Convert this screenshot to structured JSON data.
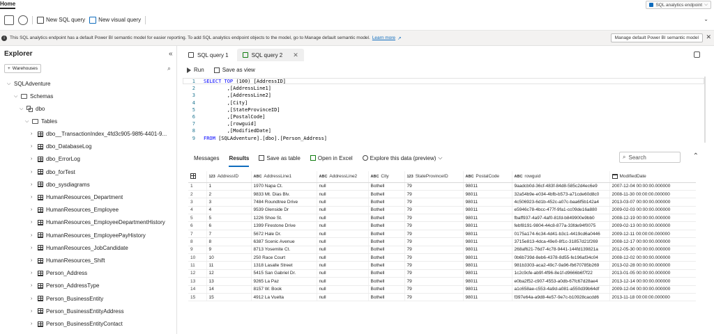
{
  "top": {
    "home_tab": "Home",
    "endpoint": "SQL analytics endpoint"
  },
  "ribbon": {
    "new_sql_query": "New SQL query",
    "new_visual_query": "New visual query"
  },
  "info": {
    "message": "This SQL analytics endpoint has a default Power BI semantic model for easier reporting. To add SQL analytics endpoint objects to the model, go to Manage default semantic model.",
    "learn_more": "Learn more",
    "manage_button": "Manage default Power BI semantic model"
  },
  "explorer": {
    "title": "Explorer",
    "warehouses_button": "Warehouses",
    "database": "SQLAdventure",
    "schemas": "Schemas",
    "schema_dbo": "dbo",
    "tables": "Tables",
    "table_items": [
      "dbo__TransactionIndex_4fd3c905-98f6-4401-9...",
      "dbo_DatabaseLog",
      "dbo_ErrorLog",
      "dbo_forTest",
      "dbo_sysdiagrams",
      "HumanResources_Department",
      "HumanResources_Employee",
      "HumanResources_EmployeeDepartmentHistory",
      "HumanResources_EmployeePayHistory",
      "HumanResources_JobCandidate",
      "HumanResources_Shift",
      "Person_Address",
      "Person_AddressType",
      "Person_BusinessEntity",
      "Person_BusinessEntityAddress",
      "Person_BusinessEntityContact"
    ]
  },
  "query_tabs": [
    {
      "label": "SQL query 1"
    },
    {
      "label": "SQL query 2"
    }
  ],
  "toolbar": {
    "run": "Run",
    "save_as_view": "Save as view"
  },
  "editor": {
    "lines": [
      {
        "n": "1",
        "kw": "SELECT TOP",
        "rest": " (100) [AddressID]"
      },
      {
        "n": "2",
        "kw": "",
        "rest": "        ,[AddressLine1]"
      },
      {
        "n": "3",
        "kw": "",
        "rest": "        ,[AddressLine2]"
      },
      {
        "n": "4",
        "kw": "",
        "rest": "        ,[City]"
      },
      {
        "n": "5",
        "kw": "",
        "rest": "        ,[StateProvinceID]"
      },
      {
        "n": "6",
        "kw": "",
        "rest": "        ,[PostalCode]"
      },
      {
        "n": "7",
        "kw": "",
        "rest": "        ,[rowguid]"
      },
      {
        "n": "8",
        "kw": "",
        "rest": "        ,[ModifiedDate]"
      },
      {
        "n": "9",
        "kw": "FROM",
        "rest": " [SQLAdventure].[dbo].[Person_Address]"
      }
    ]
  },
  "results": {
    "tab_messages": "Messages",
    "tab_results": "Results",
    "save_as_table": "Save as table",
    "open_in_excel": "Open in Excel",
    "explore": "Explore this data (preview)",
    "search_placeholder": "Search",
    "columns": [
      {
        "type": "123",
        "name": "AddressID"
      },
      {
        "type": "ABC",
        "name": "AddressLine1"
      },
      {
        "type": "ABC",
        "name": "AddressLine2"
      },
      {
        "type": "ABC",
        "name": "City"
      },
      {
        "type": "123",
        "name": "StateProvinceID"
      },
      {
        "type": "ABC",
        "name": "PostalCode"
      },
      {
        "type": "ABC",
        "name": "rowguid"
      },
      {
        "type": "",
        "name": "ModifiedDate"
      }
    ],
    "rows": [
      [
        "1",
        "1",
        "1970 Napa Ct.",
        "null",
        "Bothell",
        "79",
        "98011",
        "9aadcb0d-36cf-483f-84d8-585c2d4ec6e9",
        "2007-12-04 00:00:00.000000"
      ],
      [
        "2",
        "2",
        "9833 Mt. Dias Blv.",
        "null",
        "Bothell",
        "79",
        "98011",
        "32a54b9e-e034-4bfb-b573-a71cde60d8c0",
        "2008-11-30 00:00:00.000000"
      ],
      [
        "3",
        "3",
        "7484 Roundtree Drive",
        "null",
        "Bothell",
        "79",
        "98011",
        "4c506923-6d1b-452c-a07c-baa6f5b142a4",
        "2013-03-07 00:00:00.000000"
      ],
      [
        "4",
        "4",
        "9539 Glenside Dr",
        "null",
        "Bothell",
        "79",
        "98011",
        "e5946c78-4bcc-477f-9fa1-cc09de16a880",
        "2009-02-03 00:00:00.000000"
      ],
      [
        "5",
        "5",
        "1226 Shoe St.",
        "null",
        "Bothell",
        "79",
        "98011",
        "fbaff937-4a97-4af0-81fd-b849900e9bb0",
        "2008-12-19 00:00:00.000000"
      ],
      [
        "6",
        "6",
        "1399 Firestone Drive",
        "null",
        "Bothell",
        "79",
        "98011",
        "febf8191-9804-44c8-877a-33fde94f0075",
        "2009-02-13 00:00:00.000000"
      ],
      [
        "7",
        "7",
        "5672 Hale Dr.",
        "null",
        "Bothell",
        "79",
        "98011",
        "0175a174-6c34-4d41-b3c1-4419cd6a0446",
        "2009-12-11 00:00:00.000000"
      ],
      [
        "8",
        "8",
        "6387 Scenic Avenue",
        "null",
        "Bothell",
        "79",
        "98011",
        "3715e813-4dca-49e0-8f1c-31857d21f269",
        "2008-12-17 00:00:00.000000"
      ],
      [
        "9",
        "9",
        "8713 Yosemite Ct.",
        "null",
        "Bothell",
        "79",
        "98011",
        "268af621-76d7-4c78-9441-144fd139821a",
        "2012-05-30 00:00:00.000000"
      ],
      [
        "10",
        "10",
        "250 Race Court",
        "null",
        "Bothell",
        "79",
        "98011",
        "0b6b739d-8eb6-4378-8d55-fe196af34c04",
        "2008-12-02 00:00:00.000000"
      ],
      [
        "11",
        "11",
        "1318 Lasalle Street",
        "null",
        "Bothell",
        "79",
        "98011",
        "981b3303-aca2-49c7-9a96-fb670785b269",
        "2013-02-28 00:00:00.000000"
      ],
      [
        "12",
        "12",
        "5415 San Gabriel Dr.",
        "null",
        "Bothell",
        "79",
        "98011",
        "1c2c9cfe-ab9f-4f96-8e1f-d9666b6f7f22",
        "2013-01-05 00:00:00.000000"
      ],
      [
        "13",
        "13",
        "9265 La Paz",
        "null",
        "Bothell",
        "79",
        "98011",
        "e0ba2f52-c907-4553-a0db-67fc67d28ae4",
        "2013-12-14 00:00:00.000000"
      ],
      [
        "14",
        "14",
        "8157 W. Book",
        "null",
        "Bothell",
        "79",
        "98011",
        "a1c658ae-c553-4a9d-a081-a550d39b64df",
        "2009-12-04 00:00:00.000000"
      ],
      [
        "15",
        "15",
        "4912 La Vuelta",
        "null",
        "Bothell",
        "79",
        "98011",
        "f397e64a-a9d8-4e57-9e7c-b10928cacdd6",
        "2013-11-18 00:00:00.000000"
      ]
    ]
  }
}
